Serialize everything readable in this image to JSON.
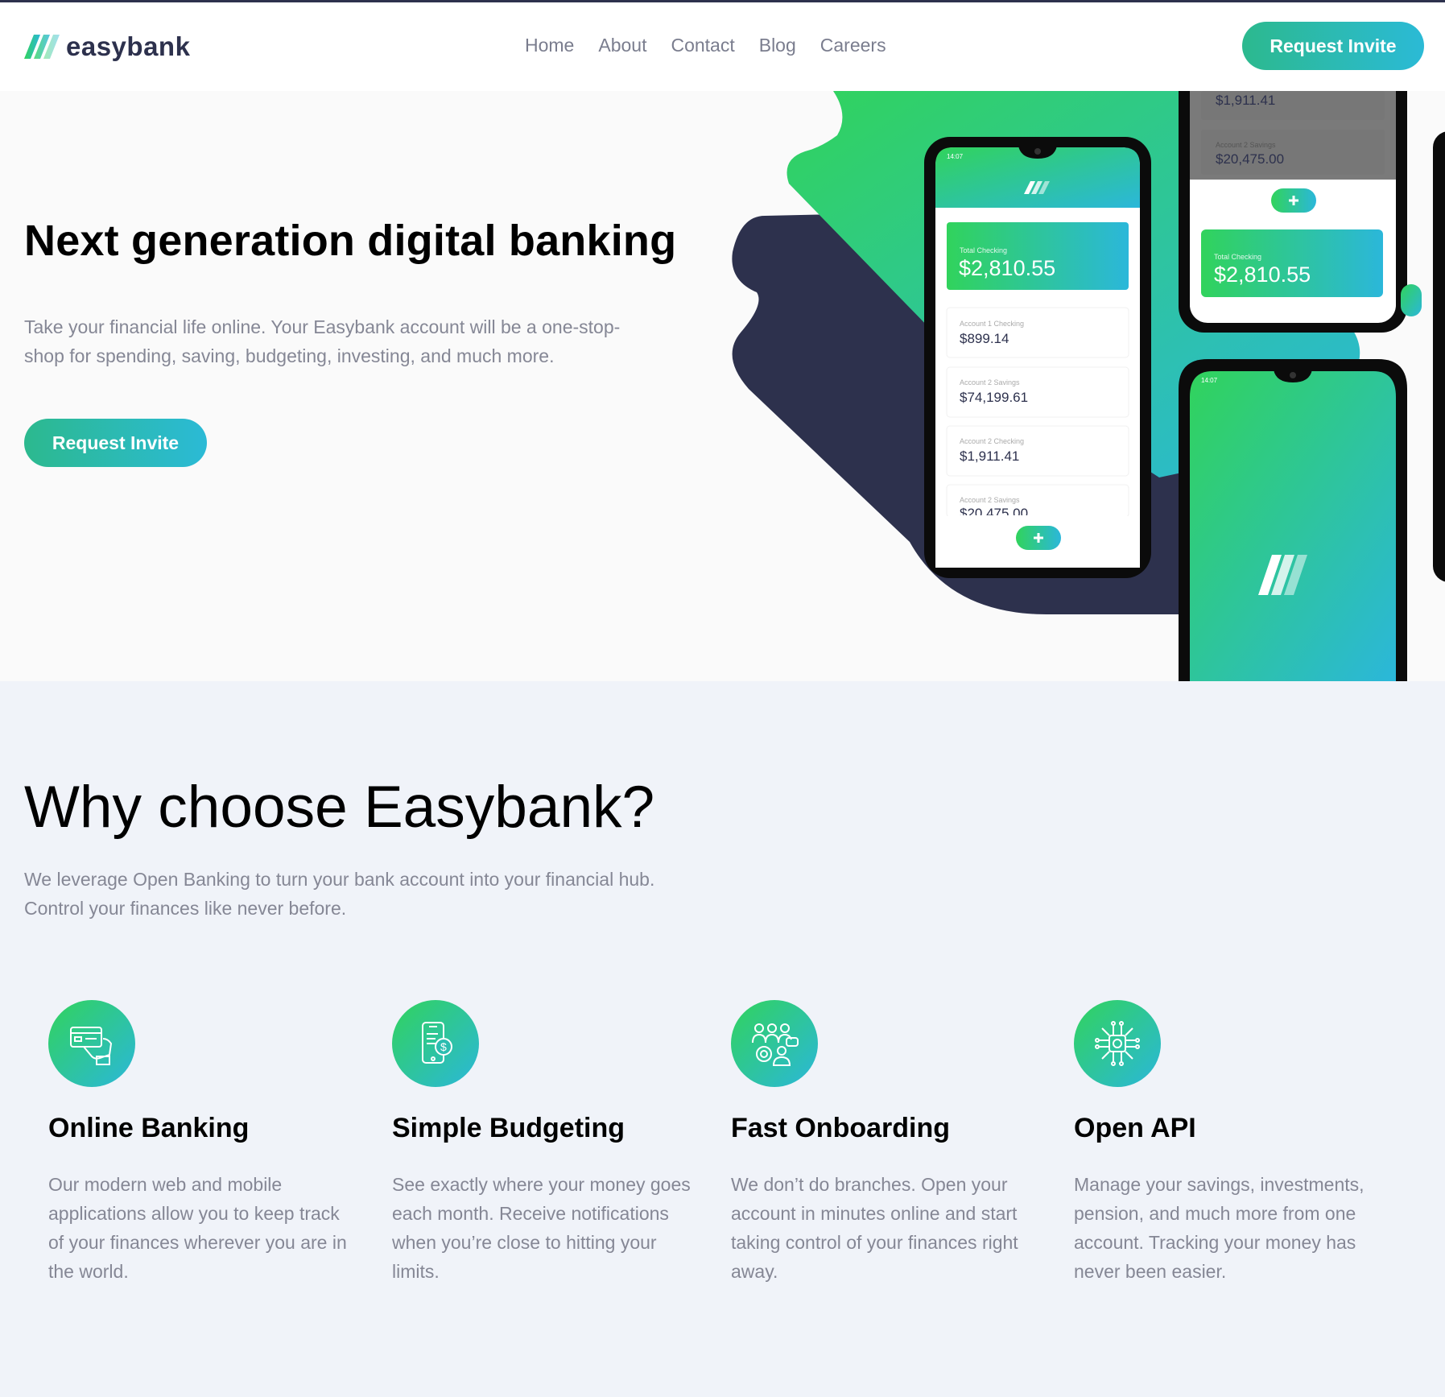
{
  "brand": {
    "name": "easybank"
  },
  "nav": {
    "items": [
      {
        "label": "Home"
      },
      {
        "label": "About"
      },
      {
        "label": "Contact"
      },
      {
        "label": "Blog"
      },
      {
        "label": "Careers"
      }
    ],
    "cta_label": "Request Invite"
  },
  "hero": {
    "title": "Next generation digital banking",
    "text": "Take your financial life online. Your Easybank account will be a one-stop-shop for spending, saving, budgeting, investing, and much more.",
    "cta_label": "Request Invite",
    "phone_left": {
      "time": "14:07",
      "total_label": "Total Checking",
      "total_amount": "$2,810.55",
      "accounts": [
        {
          "label": "Account 1 Checking",
          "amount": "$899.14"
        },
        {
          "label": "Account 2 Savings",
          "amount": "$74,199.61"
        },
        {
          "label": "Account 2 Checking",
          "amount": "$1,911.41"
        },
        {
          "label": "Account 2 Savings",
          "amount": "$20,475.00"
        }
      ]
    },
    "phone_top_right": {
      "amount_top": "$1,911.41",
      "savings_label": "Account 2 Savings",
      "savings_amount": "$20,475.00",
      "total_label": "Total Checking",
      "total_amount": "$2,810.55"
    },
    "phone_bottom_right": {
      "time": "14:07"
    }
  },
  "why": {
    "title": "Why choose Easybank?",
    "text": "We leverage Open Banking to turn your bank account into your financial hub. Control your finances like never before.",
    "features": [
      {
        "icon": "online-banking-icon",
        "title": "Online Banking",
        "text": "Our modern web and mobile applications allow you to keep track of your finances wherever you are in the world."
      },
      {
        "icon": "budgeting-icon",
        "title": "Simple Budgeting",
        "text": "See exactly where your money goes each month. Receive notifications when you’re close to hitting your limits."
      },
      {
        "icon": "onboarding-icon",
        "title": "Fast Onboarding",
        "text": "We don’t do branches. Open your account in minutes online and start taking control of your finances right away."
      },
      {
        "icon": "api-icon",
        "title": "Open API",
        "text": "Manage your savings, investments, pension, and much more from one account. Tracking your money has never been easier."
      }
    ]
  },
  "colors": {
    "dark_blue": "#2d314d",
    "lime_green": "#31d35c",
    "bright_cyan": "#2bb7da",
    "grayish_blue": "#858795",
    "light_grayish_blue": "#f0f3f9"
  }
}
